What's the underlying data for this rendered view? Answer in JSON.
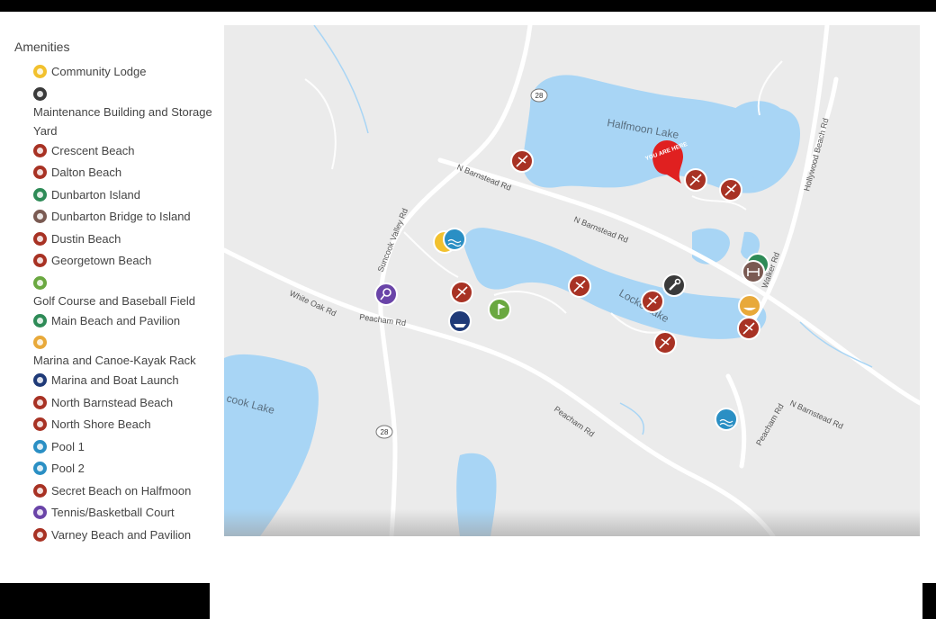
{
  "legend": {
    "title": "Amenities",
    "items": [
      {
        "label": "Community Lodge",
        "color": "#f2c12e"
      },
      {
        "label": "Maintenance Building and Storage Yard",
        "color": "#3a3a3a"
      },
      {
        "label": "Crescent Beach",
        "color": "#a83224"
      },
      {
        "label": "Dalton Beach",
        "color": "#a83224"
      },
      {
        "label": "Dunbarton Island",
        "color": "#2e8b57"
      },
      {
        "label": "Dunbarton Bridge to Island",
        "color": "#7a5a52"
      },
      {
        "label": "Dustin Beach",
        "color": "#a83224"
      },
      {
        "label": "Georgetown Beach",
        "color": "#a83224"
      },
      {
        "label": "Golf Course and Baseball Field",
        "color": "#6aa840"
      },
      {
        "label": "Main Beach and Pavilion",
        "color": "#2e8b57"
      },
      {
        "label": "Marina and Canoe-Kayak Rack",
        "color": "#e8a93a"
      },
      {
        "label": "Marina and Boat Launch",
        "color": "#1f3a78"
      },
      {
        "label": "North Barnstead Beach",
        "color": "#a83224"
      },
      {
        "label": "North Shore Beach",
        "color": "#a83224"
      },
      {
        "label": "Pool 1",
        "color": "#2a8fc4"
      },
      {
        "label": "Pool 2",
        "color": "#2a8fc4"
      },
      {
        "label": "Secret Beach on Halfmoon",
        "color": "#a83224"
      },
      {
        "label": "Tennis/Basketball Court",
        "color": "#6a44a8"
      },
      {
        "label": "Varney Beach and Pavilion",
        "color": "#a83224"
      }
    ]
  },
  "map": {
    "lakes": [
      "Halfmoon Lake",
      "Locke Lake",
      "Suncook Lake"
    ],
    "lake_label_texts": {
      "halfmoon": "Halfmoon Lake",
      "locke": "Locke Lake",
      "suncook": "cook Lake"
    },
    "roads": {
      "n_barnstead_1": "N Barnstead Rd",
      "n_barnstead_2": "N Barnstead Rd",
      "n_barnstead_3": "N Barnstead Rd",
      "suncook_valley": "Suncook Valley Rd",
      "white_oak": "White Oak Rd",
      "peacham_1": "Peacham Rd",
      "peacham_2": "Peacham Rd",
      "peacham_3": "Peacham Rd",
      "hollywood_beach": "Hollywood Beach Rd",
      "walker": "Walker Rd"
    },
    "route_shields": [
      "28",
      "28"
    ],
    "you_are_here": "YOU ARE HERE"
  }
}
